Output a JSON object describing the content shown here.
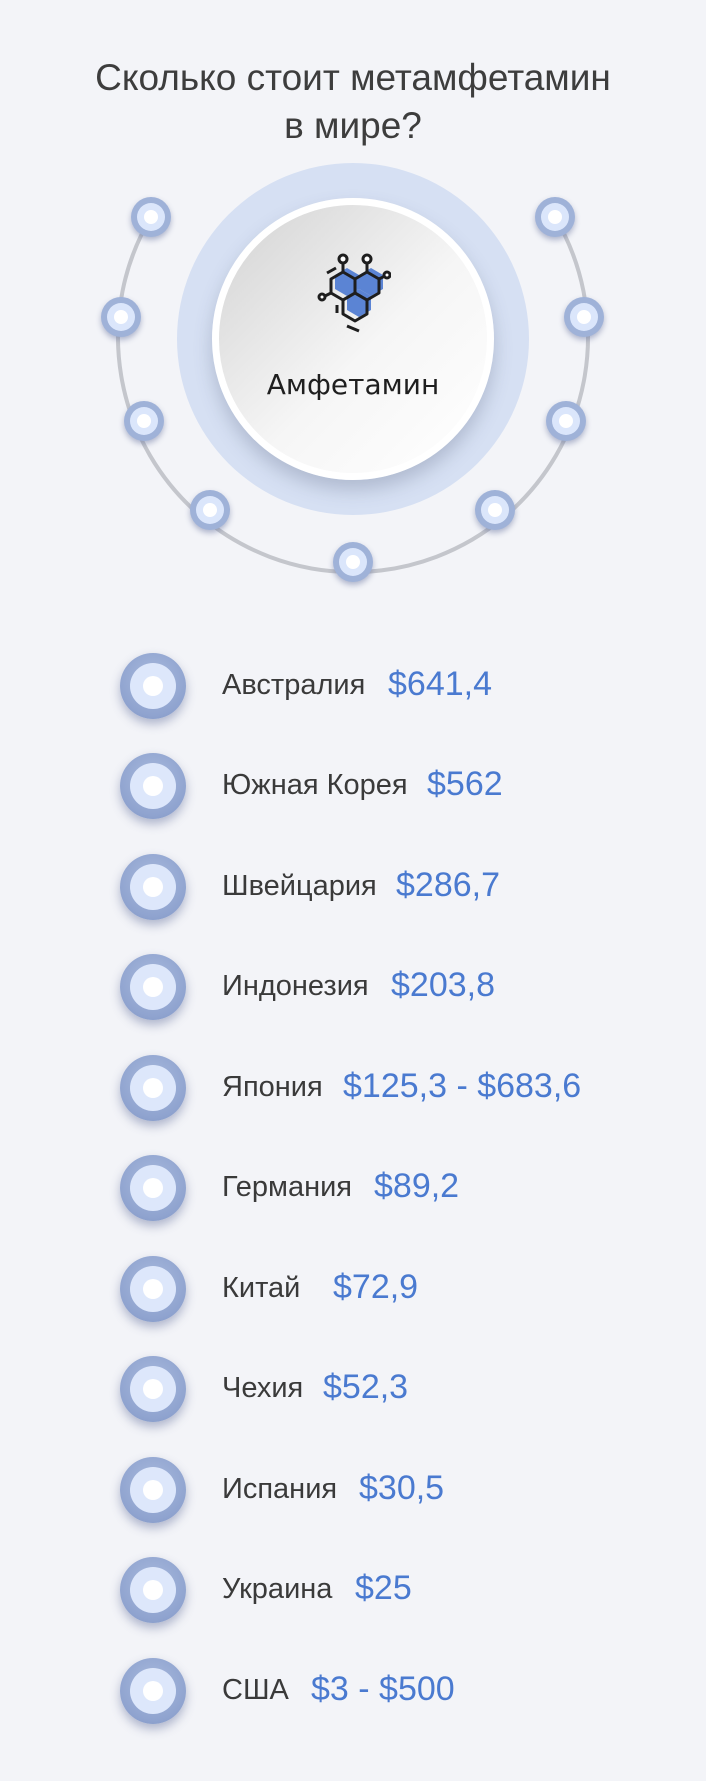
{
  "title": {
    "line1": "Сколько стоит метамфетамин",
    "line2": "в мире?"
  },
  "center": {
    "label": "Амфетамин",
    "icon": "molecule-icon"
  },
  "colors": {
    "accent": "#4a7ad0",
    "text": "#3a3a3a",
    "background": "#f3f4f8",
    "halo": "#d6e0f3"
  },
  "rows": [
    {
      "country": "Австралия",
      "price": "$641,4"
    },
    {
      "country": "Южная Корея",
      "price": "$562"
    },
    {
      "country": "Швейцария",
      "price": "$286,7"
    },
    {
      "country": "Индонезия",
      "price": "$203,8"
    },
    {
      "country": "Япония",
      "price": "$125,3 - $683,6"
    },
    {
      "country": "Германия",
      "price": "$89,2"
    },
    {
      "country": "Китай",
      "price": "$72,9"
    },
    {
      "country": "Чехия",
      "price": "$52,3"
    },
    {
      "country": "Испания",
      "price": "$30,5"
    },
    {
      "country": "Украина",
      "price": "$25"
    },
    {
      "country": "США",
      "price": "$3 - $500"
    }
  ]
}
